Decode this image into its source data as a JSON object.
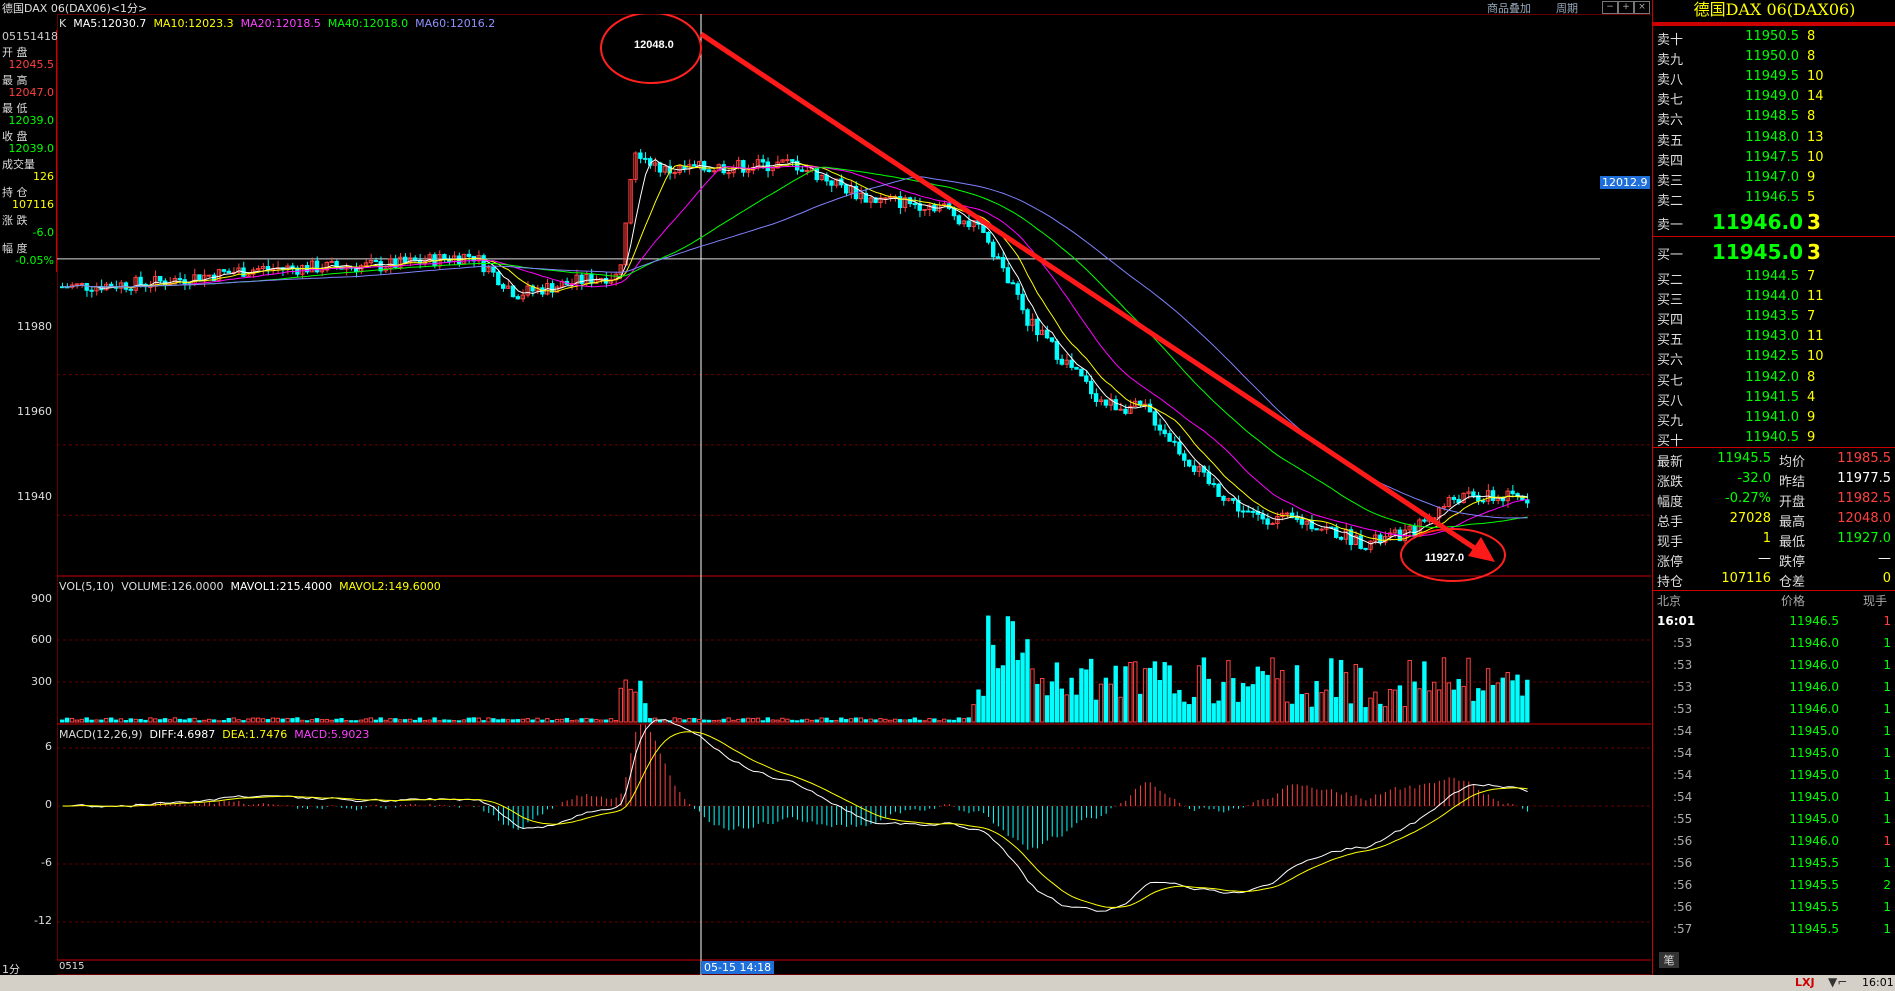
{
  "window": {
    "title": "德国DAX 06(DAX06)<1分>",
    "topright": [
      "商品叠加",
      "周期"
    ]
  },
  "left_info": [
    {
      "label": "05151418",
      "value": ""
    },
    {
      "label": "开 盘",
      "value": "12045.5"
    },
    {
      "label": "最 高",
      "value": "12047.0"
    },
    {
      "label": "最 低",
      "value": "12039.0"
    },
    {
      "label": "收 盘",
      "value": "12039.0"
    },
    {
      "label": "成交量",
      "value": "126"
    },
    {
      "label": "持 仓",
      "value": "107116"
    },
    {
      "label": "涨 跌",
      "value": "-6.0"
    },
    {
      "label": "幅 度",
      "value": "-0.05%"
    }
  ],
  "main_legend": {
    "k": "K",
    "ma5": "MA5:12030.7",
    "ma10": "MA10:12023.3",
    "ma20": "MA20:12018.5",
    "ma40": "MA40:12018.0",
    "ma60": "MA60:12016.2"
  },
  "vol_legend": {
    "a": "VOL(5,10)",
    "b": "VOLUME:126.0000",
    "c": "MAVOL1:215.4000",
    "d": "MAVOL2:149.6000"
  },
  "macd_legend": {
    "a": "MACD(12,26,9)",
    "b": "DIFF:4.6987",
    "c": "DEA:1.7476",
    "d": "MACD:5.9023"
  },
  "annotations": {
    "high": "12048.0",
    "low": "11927.0",
    "hline": "12012.9",
    "crosshair_time": "05-15 14:18",
    "date_left": "0515",
    "period": "1分"
  },
  "chart_data": {
    "type": "candlestick",
    "price_ticks": [
      "11980",
      "11960",
      "11940"
    ],
    "vol_ticks": [
      "900",
      "600",
      "300"
    ],
    "macd_ticks": [
      "6",
      "0",
      "-6",
      "-12"
    ],
    "high": 12048.0,
    "low": 11927.0,
    "ylim": [
      11923,
      12078
    ],
    "colors": {
      "up": "#ff4040",
      "down": "#00ffff",
      "ma5": "#ffffff",
      "ma10": "#ffff00",
      "ma20": "#ff00ff",
      "ma40": "#00ff00",
      "ma60": "#8080ff"
    }
  },
  "panel": {
    "title": "德国DAX  06(DAX06)",
    "asks": [
      {
        "label": "卖十",
        "price": "11950.5",
        "qty": "8"
      },
      {
        "label": "卖九",
        "price": "11950.0",
        "qty": "8"
      },
      {
        "label": "卖八",
        "price": "11949.5",
        "qty": "10"
      },
      {
        "label": "卖七",
        "price": "11949.0",
        "qty": "14"
      },
      {
        "label": "卖六",
        "price": "11948.5",
        "qty": "8"
      },
      {
        "label": "卖五",
        "price": "11948.0",
        "qty": "13"
      },
      {
        "label": "卖四",
        "price": "11947.5",
        "qty": "10"
      },
      {
        "label": "卖三",
        "price": "11947.0",
        "qty": "9"
      },
      {
        "label": "卖二",
        "price": "11946.5",
        "qty": "5"
      }
    ],
    "ask1": {
      "label": "卖一",
      "price": "11946.0",
      "qty": "3"
    },
    "bid1": {
      "label": "买一",
      "price": "11945.0",
      "qty": "3"
    },
    "bids": [
      {
        "label": "买二",
        "price": "11944.5",
        "qty": "7"
      },
      {
        "label": "买三",
        "price": "11944.0",
        "qty": "11"
      },
      {
        "label": "买四",
        "price": "11943.5",
        "qty": "7"
      },
      {
        "label": "买五",
        "price": "11943.0",
        "qty": "11"
      },
      {
        "label": "买六",
        "price": "11942.5",
        "qty": "10"
      },
      {
        "label": "买七",
        "price": "11942.0",
        "qty": "8"
      },
      {
        "label": "买八",
        "price": "11941.5",
        "qty": "4"
      },
      {
        "label": "买九",
        "price": "11941.0",
        "qty": "9"
      },
      {
        "label": "买十",
        "price": "11940.5",
        "qty": "9"
      }
    ],
    "info": [
      {
        "l1": "最新",
        "v1": "11945.5",
        "c1": "green",
        "l2": "均价",
        "v2": "11985.5",
        "c2": "red"
      },
      {
        "l1": "涨跌",
        "v1": "-32.0",
        "c1": "green",
        "l2": "昨结",
        "v2": "11977.5",
        "c2": "white"
      },
      {
        "l1": "幅度",
        "v1": "-0.27%",
        "c1": "green",
        "l2": "开盘",
        "v2": "11982.5",
        "c2": "red"
      },
      {
        "l1": "总手",
        "v1": "27028",
        "c1": "yellow",
        "l2": "最高",
        "v2": "12048.0",
        "c2": "red"
      },
      {
        "l1": "现手",
        "v1": "1",
        "c1": "yellow",
        "l2": "最低",
        "v2": "11927.0",
        "c2": "green"
      },
      {
        "l1": "涨停",
        "v1": "—",
        "c1": "white",
        "l2": "跌停",
        "v2": "—",
        "c2": "white"
      },
      {
        "l1": "持仓",
        "v1": "107116",
        "c1": "yellow",
        "l2": "仓差",
        "v2": "0",
        "c2": "yellow"
      }
    ],
    "ticks_header": {
      "time": "北京",
      "price": "价格",
      "qty": "现手"
    },
    "ticks": [
      {
        "t": "16:01",
        "p": "11946.5",
        "q": "1",
        "qc": "red"
      },
      {
        "t": ":53",
        "p": "11946.0",
        "q": "1",
        "qc": "green"
      },
      {
        "t": ":53",
        "p": "11946.0",
        "q": "1",
        "qc": "green"
      },
      {
        "t": ":53",
        "p": "11946.0",
        "q": "1",
        "qc": "green"
      },
      {
        "t": ":53",
        "p": "11946.0",
        "q": "1",
        "qc": "green"
      },
      {
        "t": ":54",
        "p": "11945.0",
        "q": "1",
        "qc": "green"
      },
      {
        "t": ":54",
        "p": "11945.0",
        "q": "1",
        "qc": "green"
      },
      {
        "t": ":54",
        "p": "11945.0",
        "q": "1",
        "qc": "green"
      },
      {
        "t": ":54",
        "p": "11945.0",
        "q": "1",
        "qc": "green"
      },
      {
        "t": ":55",
        "p": "11945.0",
        "q": "1",
        "qc": "green"
      },
      {
        "t": ":56",
        "p": "11946.0",
        "q": "1",
        "qc": "red"
      },
      {
        "t": ":56",
        "p": "11945.5",
        "q": "1",
        "qc": "green"
      },
      {
        "t": ":56",
        "p": "11945.5",
        "q": "2",
        "qc": "green"
      },
      {
        "t": ":56",
        "p": "11945.5",
        "q": "1",
        "qc": "green"
      },
      {
        "t": ":57",
        "p": "11945.5",
        "q": "1",
        "qc": "green"
      }
    ],
    "bottom_tab": "笔",
    "status_time": "16:01"
  }
}
